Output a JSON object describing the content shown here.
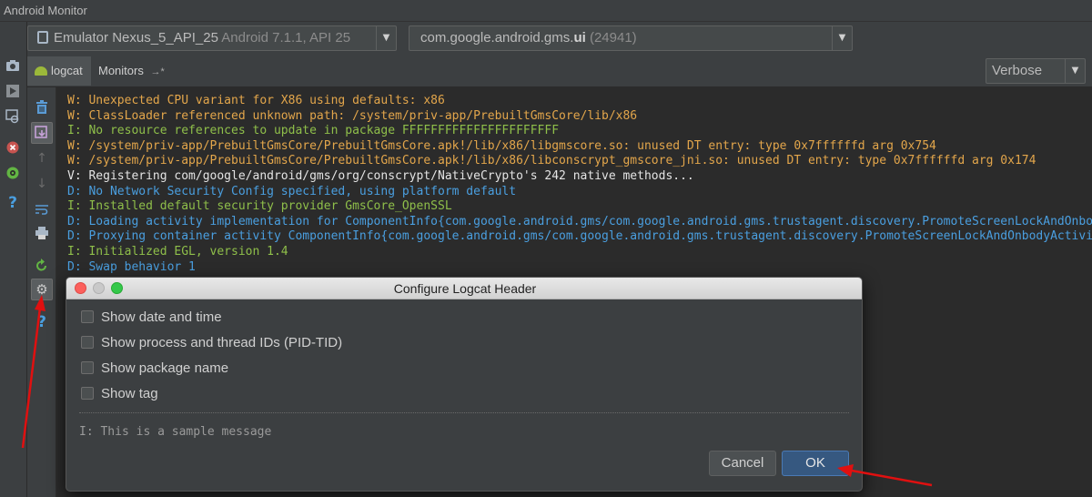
{
  "window": {
    "title": "Android Monitor"
  },
  "device_bar": {
    "device_name": "Emulator Nexus_5_API_25",
    "device_detail": "Android 7.1.1, API 25",
    "process_name": "com.google.android.gms.",
    "process_name_bold": "ui",
    "process_pid": "(24941)"
  },
  "tabs": [
    {
      "label": "logcat"
    },
    {
      "label": "Monitors"
    },
    {
      "label": "→*"
    }
  ],
  "log_level": {
    "selected": "Verbose"
  },
  "colors": {
    "warn": "#bbb529",
    "info": "#6a8759",
    "debug": "#6897bb",
    "verbose": "#d4d4d4",
    "ok_button": "#365880",
    "annotation": "#e01010"
  },
  "left_strip_icons": [
    "camera-icon",
    "play-icon",
    "screen-record-icon",
    "stop-icon",
    "layout-icon",
    "help-icon"
  ],
  "logcat_toolbar_icons": [
    "trash-icon",
    "scroll-to-end-icon",
    "up-arrow-icon",
    "down-arrow-icon",
    "soft-wrap-icon",
    "print-icon",
    "restart-icon",
    "settings-gear-icon",
    "help-icon"
  ],
  "logs": [
    {
      "level": "warn",
      "text": "W: Unexpected CPU variant for X86 using defaults: x86"
    },
    {
      "level": "warn",
      "text": "W: ClassLoader referenced unknown path: /system/priv-app/PrebuiltGmsCore/lib/x86"
    },
    {
      "level": "info",
      "text": "I: No resource references to update in package FFFFFFFFFFFFFFFFFFFFFF"
    },
    {
      "level": "warn",
      "text": "W: /system/priv-app/PrebuiltGmsCore/PrebuiltGmsCore.apk!/lib/x86/libgmscore.so: unused DT entry: type 0x7ffffffd arg 0x754"
    },
    {
      "level": "warn",
      "text": "W: /system/priv-app/PrebuiltGmsCore/PrebuiltGmsCore.apk!/lib/x86/libconscrypt_gmscore_jni.so: unused DT entry: type 0x7ffffffd arg 0x174"
    },
    {
      "level": "verbose",
      "text": "V: Registering com/google/android/gms/org/conscrypt/NativeCrypto's 242 native methods..."
    },
    {
      "level": "debug",
      "text": "D: No Network Security Config specified, using platform default"
    },
    {
      "level": "info",
      "text": "I: Installed default security provider GmsCore_OpenSSL"
    },
    {
      "level": "debug",
      "text": "D: Loading activity implementation for ComponentInfo{com.google.android.gms/com.google.android.gms.trustagent.discovery.PromoteScreenLockAndOnbod"
    },
    {
      "level": "debug",
      "text": "D: Proxying container activity ComponentInfo{com.google.android.gms/com.google.android.gms.trustagent.discovery.PromoteScreenLockAndOnbodyActivit"
    },
    {
      "level": "info",
      "text": "I: Initialized EGL, version 1.4"
    },
    {
      "level": "debug",
      "text": "D: Swap behavior 1"
    }
  ],
  "dialog": {
    "title": "Configure Logcat Header",
    "options": [
      {
        "label": "Show date and time",
        "checked": false
      },
      {
        "label": "Show process and thread IDs (PID-TID)",
        "checked": false
      },
      {
        "label": "Show package name",
        "checked": false
      },
      {
        "label": "Show tag",
        "checked": false
      }
    ],
    "sample_message": "I: This is a sample message",
    "cancel_label": "Cancel",
    "ok_label": "OK"
  }
}
